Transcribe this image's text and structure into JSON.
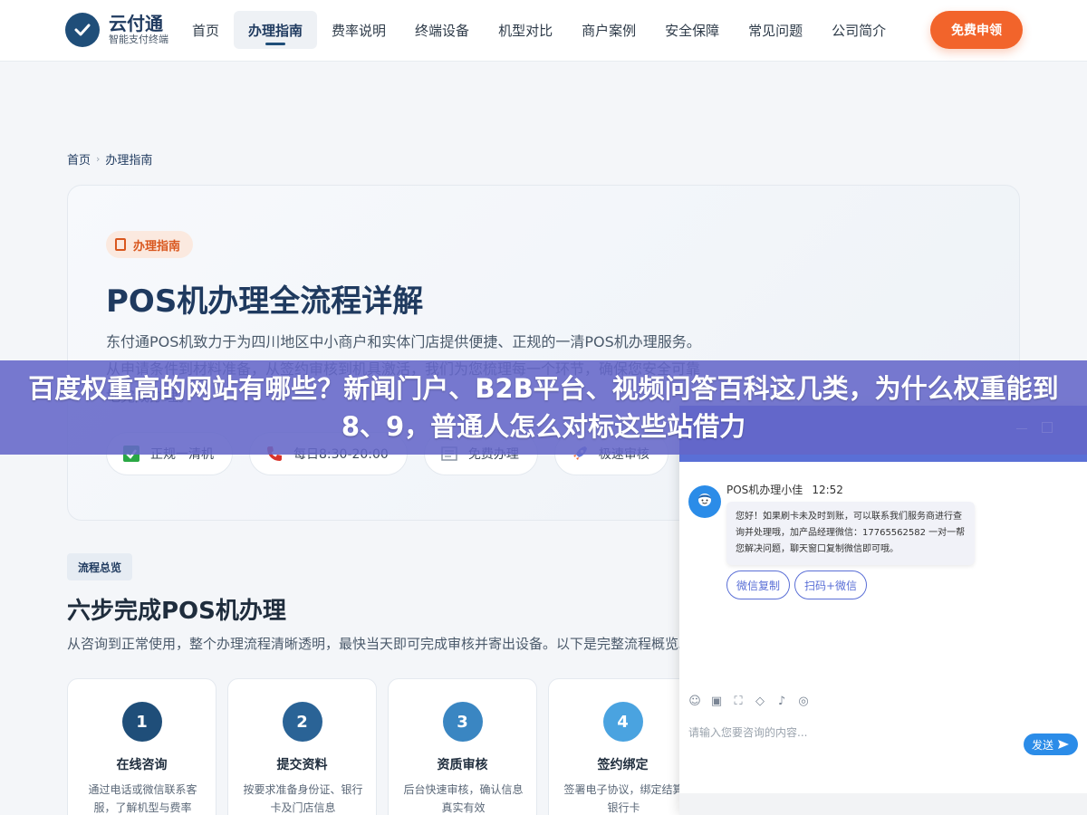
{
  "header": {
    "logo": {
      "name": "云付通",
      "tagline": "智能支付终端"
    },
    "nav": [
      {
        "label": "首页"
      },
      {
        "label": "办理指南",
        "active": true
      },
      {
        "label": "费率说明"
      },
      {
        "label": "终端设备"
      },
      {
        "label": "机型对比"
      },
      {
        "label": "商户案例"
      },
      {
        "label": "安全保障"
      },
      {
        "label": "常见问题"
      },
      {
        "label": "公司简介"
      }
    ],
    "cta_label": "免费申领"
  },
  "breadcrumb": {
    "home": "首页",
    "current": "办理指南"
  },
  "hero": {
    "badge": "办理指南",
    "title": "POS机办理全流程详解",
    "description": "东付通POS机致力于为四川地区中小商户和实体门店提供便捷、正规的一清POS机办理服务。从申请条件到材料准备，从签约审核到机具激活，我们为您梳理每一个环节，确保您安全可靠地完成办理。",
    "chips": [
      {
        "icon": "check-square-icon",
        "label": "正规一清机"
      },
      {
        "icon": "phone-icon",
        "label": "每日8:30-20:00"
      },
      {
        "icon": "free-icon",
        "label": "免费办理"
      },
      {
        "icon": "rocket-icon",
        "label": "极速审核"
      }
    ]
  },
  "process": {
    "badge": "流程总览",
    "title": "六步完成POS机办理",
    "description": "从咨询到正常使用，整个办理流程清晰透明，最快当天即可完成审核并寄出设备。以下是完整流程概览。",
    "steps": [
      {
        "number": "1",
        "title": "在线咨询",
        "desc": "通过电话或微信联系客服，了解机型与费率"
      },
      {
        "number": "2",
        "title": "提交资料",
        "desc": "按要求准备身份证、银行卡及门店信息"
      },
      {
        "number": "3",
        "title": "资质审核",
        "desc": "后台快速审核，确认信息真实有效"
      },
      {
        "number": "4",
        "title": "签约绑定",
        "desc": "签署电子协议，绑定结算银行卡"
      }
    ]
  },
  "overlay": {
    "headline": "百度权重高的网站有哪些？新闻门户、B2B平台、视频问答百科这几类，为什么权重能到8、9，普通人怎么对标这些站借力"
  },
  "chat": {
    "agent_name": "POS机办理小佳",
    "time": "12:52",
    "message": "您好！如果刷卡未及时到账，可以联系我们服务商进行查询并处理哦，加产品经理微信：17765562582 一对一帮您解决问题，聊天窗口复制微信即可哦。",
    "quick_replies": [
      "微信复制",
      "扫码+微信"
    ],
    "input_placeholder": "请输入您要咨询的内容...",
    "send_label": "发送",
    "colors": {
      "header": "#5a6fd6",
      "accent": "#2b8ce8"
    }
  },
  "colors": {
    "brand_navy": "#1f3a5f",
    "cta_orange": "#f2642b",
    "overlay": "#6467c8"
  }
}
